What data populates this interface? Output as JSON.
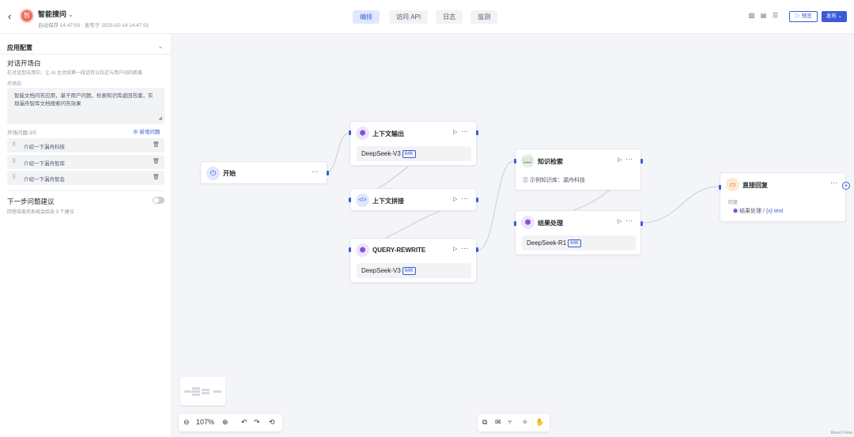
{
  "header": {
    "back_icon": "chevron-left-icon",
    "app_avatar_text": "智",
    "app_name": "智能搜问",
    "meta": "自动保存 14:47:03 · 发布于 2025-02-14 14:47:01",
    "tabs": [
      {
        "label": "编排",
        "active": true
      },
      {
        "label": "访问 API",
        "active": false
      },
      {
        "label": "日志",
        "active": false
      },
      {
        "label": "监测",
        "active": false
      }
    ],
    "preview_label": "▷ 预览",
    "publish_label": "发布 ⌄"
  },
  "sidebar": {
    "section_title": "应用配置",
    "opening": {
      "title": "对话开场白",
      "desc": "在对话型应用中，让 AI 主动说第一段话可以拉近与用户间的距离",
      "label": "开场白",
      "text": "智能文档问答应用，基于用户问题，检索知识库返回答案，实现漏舟智库文档搜索问答效果"
    },
    "questions_count": "开场问题 3/5",
    "add_question": "新增问题",
    "questions": [
      "介绍一下漏舟科技",
      "介绍一下漏舟智库",
      "介绍一下漏舟智会"
    ],
    "next_suggest": {
      "title": "下一步问题建议",
      "desc": "回答结束后系统会给出 3 个建议",
      "enabled": false
    }
  },
  "canvas": {
    "nodes": {
      "start": {
        "title": "开始",
        "icon": "power-icon"
      },
      "ctx_output": {
        "title": "上下文输出",
        "model": "DeepSeek-V3",
        "badge": "64K"
      },
      "ctx_concat": {
        "title": "上下文拼接"
      },
      "query_rewrite": {
        "title": "QUERY-REWRITE",
        "model": "DeepSeek-V3",
        "badge": "64K"
      },
      "knowledge": {
        "title": "知识检索",
        "kb": "示例知识库：漏舟科技"
      },
      "result": {
        "title": "结果处理",
        "model": "DeepSeek-R1",
        "badge": "64K"
      },
      "reply": {
        "title": "直接回复",
        "label": "回复",
        "source": "结果处理 /",
        "var": "{x} text"
      }
    },
    "zoom": "107%",
    "watermark": "React Flow"
  },
  "colors": {
    "accent": "#3b5bdb",
    "start_icon_bg": "#e0e7ff",
    "llm_icon_bg": "#ede4fb",
    "kb_icon_bg": "#dcf5e1",
    "reply_icon_bg": "#fde8d3"
  }
}
